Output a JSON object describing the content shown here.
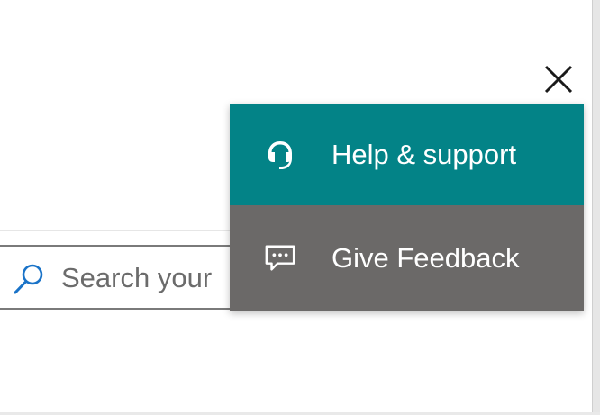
{
  "colors": {
    "help_bg": "#038387",
    "feedback_bg": "#6b6968",
    "menu_text": "#ffffff",
    "search_icon": "#1a73c8",
    "search_border": "#7a7a7a"
  },
  "close": {
    "icon": "close-icon"
  },
  "search": {
    "icon": "search-icon",
    "placeholder": "Search your"
  },
  "menu": {
    "items": [
      {
        "icon": "headset-icon",
        "label": "Help & support"
      },
      {
        "icon": "chat-bubble-icon",
        "label": "Give Feedback"
      }
    ]
  }
}
